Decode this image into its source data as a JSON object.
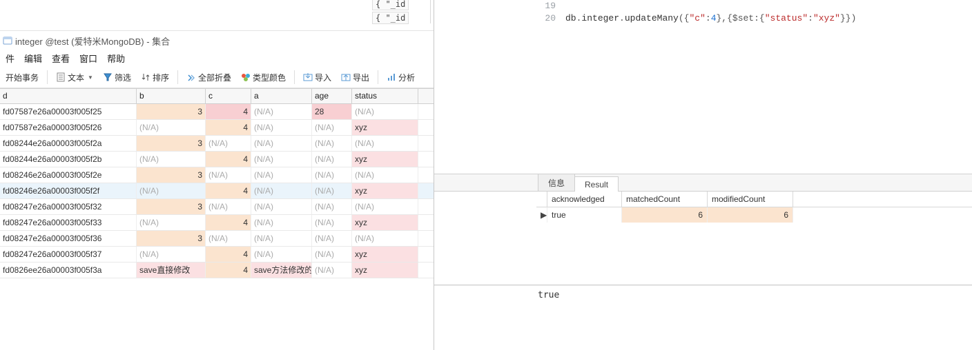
{
  "window": {
    "title": "integer @test (爱特米MongoDB) - 集合"
  },
  "menu": {
    "file": "件",
    "edit": "编辑",
    "view": "查看",
    "window": "窗口",
    "help": "帮助"
  },
  "toolbar": {
    "begin_tx": "开始事务",
    "text": "文本",
    "filter": "筛选",
    "sort": "排序",
    "collapse": "全部折叠",
    "type_color": "类型颜色",
    "import": "导入",
    "export": "导出",
    "analyze": "分析"
  },
  "table": {
    "headers": {
      "id": "d",
      "b": "b",
      "c": "c",
      "a": "a",
      "age": "age",
      "status": "status"
    },
    "rows": [
      {
        "id": "fd07587e26a00003f005f25",
        "b": "3",
        "c": "4",
        "a": "(N/A)",
        "age": "28",
        "status": "(N/A)",
        "cls": {
          "b": "bg-orange",
          "c": "bg-pink",
          "a": "na",
          "age": "bg-pink",
          "status": "na"
        }
      },
      {
        "id": "fd07587e26a00003f005f26",
        "b": "(N/A)",
        "c": "4",
        "a": "(N/A)",
        "age": "(N/A)",
        "status": "xyz",
        "cls": {
          "b": "na",
          "c": "bg-orange",
          "a": "na",
          "age": "na",
          "status": "bg-lpink"
        }
      },
      {
        "id": "fd08244e26a00003f005f2a",
        "b": "3",
        "c": "(N/A)",
        "a": "(N/A)",
        "age": "(N/A)",
        "status": "(N/A)",
        "cls": {
          "b": "bg-orange",
          "c": "na",
          "a": "na",
          "age": "na",
          "status": "na"
        }
      },
      {
        "id": "fd08244e26a00003f005f2b",
        "b": "(N/A)",
        "c": "4",
        "a": "(N/A)",
        "age": "(N/A)",
        "status": "xyz",
        "cls": {
          "b": "na",
          "c": "bg-orange",
          "a": "na",
          "age": "na",
          "status": "bg-lpink"
        }
      },
      {
        "id": "fd08246e26a00003f005f2e",
        "b": "3",
        "c": "(N/A)",
        "a": "(N/A)",
        "age": "(N/A)",
        "status": "(N/A)",
        "cls": {
          "b": "bg-orange",
          "c": "na",
          "a": "na",
          "age": "na",
          "status": "na"
        }
      },
      {
        "id": "fd08246e26a00003f005f2f",
        "b": "(N/A)",
        "c": "4",
        "a": "(N/A)",
        "age": "(N/A)",
        "status": "xyz",
        "cls": {
          "row": "bg-lblue",
          "b": "na",
          "c": "bg-orange",
          "a": "na",
          "age": "na",
          "status": "bg-lpink"
        }
      },
      {
        "id": "fd08247e26a00003f005f32",
        "b": "3",
        "c": "(N/A)",
        "a": "(N/A)",
        "age": "(N/A)",
        "status": "(N/A)",
        "cls": {
          "b": "bg-orange",
          "c": "na",
          "a": "na",
          "age": "na",
          "status": "na"
        }
      },
      {
        "id": "fd08247e26a00003f005f33",
        "b": "(N/A)",
        "c": "4",
        "a": "(N/A)",
        "age": "(N/A)",
        "status": "xyz",
        "cls": {
          "b": "na",
          "c": "bg-orange",
          "a": "na",
          "age": "na",
          "status": "bg-lpink"
        }
      },
      {
        "id": "fd08247e26a00003f005f36",
        "b": "3",
        "c": "(N/A)",
        "a": "(N/A)",
        "age": "(N/A)",
        "status": "(N/A)",
        "cls": {
          "b": "bg-orange",
          "c": "na",
          "a": "na",
          "age": "na",
          "status": "na"
        }
      },
      {
        "id": "fd08247e26a00003f005f37",
        "b": "(N/A)",
        "c": "4",
        "a": "(N/A)",
        "age": "(N/A)",
        "status": "xyz",
        "cls": {
          "b": "na",
          "c": "bg-orange",
          "a": "na",
          "age": "na",
          "status": "bg-lpink"
        }
      },
      {
        "id": "fd0826ee26a00003f005f3a",
        "b": "save直接修改",
        "c": "4",
        "a": "save方法修改的",
        "age": "(N/A)",
        "status": "xyz",
        "cls": {
          "b": "bg-lpink left",
          "c": "bg-orange",
          "a": "bg-lpink",
          "age": "na",
          "status": "bg-lpink"
        }
      }
    ]
  },
  "fragment": {
    "l1": "{ \"_id",
    "l2": "{ \"_id"
  },
  "code": {
    "lines": [
      {
        "n": "19",
        "t": ""
      },
      {
        "n": "20",
        "segments": [
          {
            "c": "tk-plain",
            "t": "db"
          },
          {
            "c": "tk-punc",
            "t": "."
          },
          {
            "c": "tk-plain",
            "t": "integer"
          },
          {
            "c": "tk-punc",
            "t": "."
          },
          {
            "c": "tk-plain",
            "t": "updateMany"
          },
          {
            "c": "tk-punc",
            "t": "({"
          },
          {
            "c": "tk-str",
            "t": "\"c\""
          },
          {
            "c": "tk-punc",
            "t": ":"
          },
          {
            "c": "tk-num",
            "t": "4"
          },
          {
            "c": "tk-punc",
            "t": "},{$set:{"
          },
          {
            "c": "tk-str",
            "t": "\"status\""
          },
          {
            "c": "tk-punc",
            "t": ":"
          },
          {
            "c": "tk-str",
            "t": "\"xyz\""
          },
          {
            "c": "tk-punc",
            "t": "}})"
          }
        ]
      }
    ]
  },
  "tabs": {
    "info": "信息",
    "result": "Result"
  },
  "result": {
    "headers": {
      "ack": "acknowledged",
      "matched": "matchedCount",
      "modified": "modifiedCount"
    },
    "row": {
      "ack": "true",
      "matched": "6",
      "modified": "6"
    }
  },
  "console": {
    "line": "true"
  }
}
